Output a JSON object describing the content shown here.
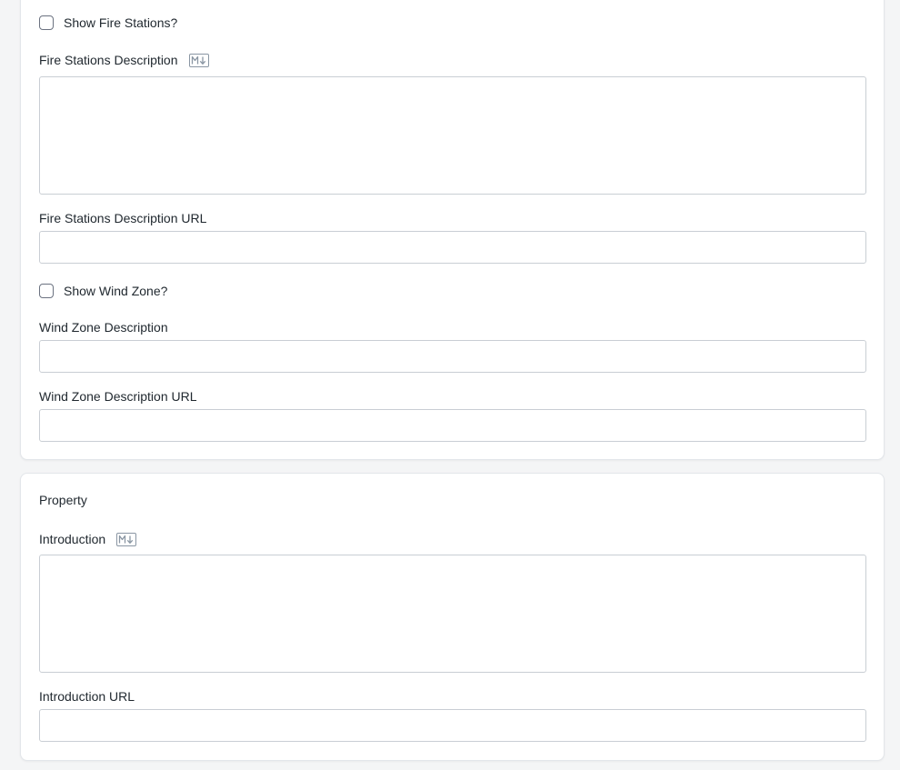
{
  "fire_section": {
    "show_fire_stations": {
      "label": "Show Fire Stations?",
      "checked": false
    },
    "fire_stations_description": {
      "label": "Fire Stations Description",
      "icon": "markdown-icon",
      "value": "",
      "placeholder": ""
    },
    "fire_stations_description_url": {
      "label": "Fire Stations Description URL",
      "value": "",
      "placeholder": ""
    },
    "show_wind_zone": {
      "label": "Show Wind Zone?",
      "checked": false
    },
    "wind_zone_description": {
      "label": "Wind Zone Description",
      "value": "",
      "placeholder": ""
    },
    "wind_zone_description_url": {
      "label": "Wind Zone Description URL",
      "value": "",
      "placeholder": ""
    }
  },
  "property_section": {
    "title": "Property",
    "introduction": {
      "label": "Introduction",
      "icon": "markdown-icon",
      "value": "",
      "placeholder": ""
    },
    "introduction_url": {
      "label": "Introduction URL",
      "value": "",
      "placeholder": ""
    }
  },
  "colors": {
    "background": "#f4f5f6",
    "card": "#ffffff",
    "border": "#c9ced4",
    "text": "#1f272e",
    "icon": "#8a96a3"
  }
}
